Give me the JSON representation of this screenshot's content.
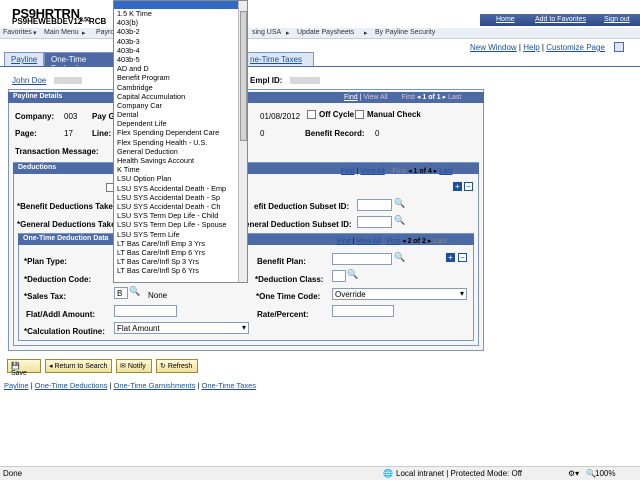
{
  "header": {
    "product_line1": "PS9HRTRN",
    "product_version": "8.50",
    "product_line2": "PS9HEWEBDEV12",
    "product_suffix": "RCB",
    "links": [
      "Home",
      "Add to Favorites",
      "Sign out"
    ]
  },
  "nav": {
    "items": [
      "Favorites",
      "Main Menu",
      "Payro",
      "sing USA",
      "Update Paysheets",
      "By Payline Security"
    ],
    "separators": "▾"
  },
  "right_links": {
    "new_window": "New Window",
    "help": "Help",
    "customize": "Customize Page"
  },
  "tabs": [
    "Payline",
    "One-Time Deductio",
    "ne-Time Taxes"
  ],
  "employee": {
    "name_link": "John Doe",
    "empl_id_label": "Empl ID:"
  },
  "payline_details": {
    "title": "Payline Details",
    "nav_find": "Find",
    "nav_viewall": "View All",
    "nav_first": "First",
    "nav_count": "1 of 1",
    "nav_last": "Last",
    "company_label": "Company:",
    "company_value": "003",
    "pay_group_label": "Pay G",
    "date_value": "01/08/2012",
    "off_cycle_label": "Off Cycle",
    "manual_check_label": "Manual Check",
    "page_label": "Page:",
    "page_value": "17",
    "line_label": "Line:",
    "line_value": "0",
    "benefit_record_label": "Benefit Record:",
    "benefit_record_value": "0",
    "transaction_label": "Transaction Message:"
  },
  "deductions": {
    "title": "Deductions",
    "nav_find": "Find",
    "nav_viewall": "View All",
    "nav_first": "First",
    "nav_count": "1 of 4",
    "nav_last": "Last",
    "benefit_taken_label": "*Benefit Deductions Taken:",
    "general_taken_label": "*General Deductions Taken",
    "benefit_subset_label": "efit Deduction Subset ID:",
    "general_subset_label": "eneral Deduction Subset ID:"
  },
  "one_time": {
    "title": "One-Time Deduction Data",
    "nav_find": "Find",
    "nav_viewall": "View All",
    "nav_first": "First",
    "nav_count": "2 of 2",
    "nav_last": "Last",
    "plan_type_label": "*Plan Type:",
    "benefit_plan_label": "Benefit Plan:",
    "deduction_code_label": "*Deduction Code:",
    "deduction_class_label": "*Deduction Class:",
    "sales_tax_label": "*Sales Tax:",
    "sales_tax_value": "B",
    "sales_tax_desc": "None",
    "one_time_code_label": "*One Time Code:",
    "one_time_code_value": "Override",
    "flat_addl_label": "Flat/Addl Amount:",
    "rate_label": "Rate/Percent:",
    "calc_routine_label": "*Calculation Routine:",
    "calc_routine_value": "Flat Amount"
  },
  "buttons": {
    "save": "Save",
    "return": "Return to Search",
    "notify": "Notify",
    "refresh": "Refresh"
  },
  "footer_links": [
    "Payline",
    "One-Time Deductions",
    "One-Time Garnishments",
    "One-Time Taxes"
  ],
  "dropdown_options": [
    "",
    "1.5 K Time",
    "403(b)",
    "403b-2",
    "403b-3",
    "403b-4",
    "403b-5",
    "AD and D",
    "Benefit Program",
    "Cambridge",
    "Capital Accumulation",
    "Company Car",
    "Dental",
    "Dependent Life",
    "Flex Spending Dependent Care",
    "Flex Spending Health - U.S.",
    "General Deduction",
    "Health Savings Account",
    "K Time",
    "LSU Option Plan",
    "LSU SYS Accidental Death - Emp",
    "LSU SYS Accidental Death - Sp",
    "LSU SYS Accidental Death - Ch",
    "LSU SYS Term Dep Life - Child",
    "LSU SYS Term Dep Life - Spouse",
    "LSU SYS Term Life",
    "LT Bas Care/Infl Emp 3 Yrs",
    "LT Bas Care/Infl Emp 6 Yrs",
    "LT Bas Care/Infl Sp 3 Yrs",
    "LT Bas Care/Infl Sp 6 Yrs"
  ],
  "statusbar": {
    "left": "Done",
    "zone": "Local intranet | Protected Mode: Off",
    "zoom": "100%"
  }
}
